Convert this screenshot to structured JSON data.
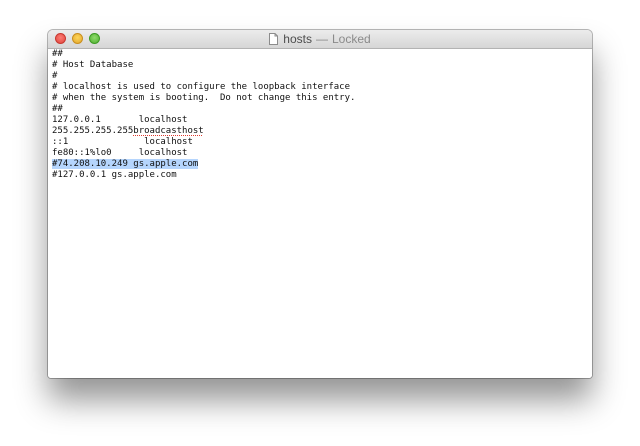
{
  "window": {
    "filename": "hosts",
    "separator": "—",
    "status": "Locked",
    "icon": "document-icon"
  },
  "colors": {
    "selection": "#b5d5fd",
    "close": "#e0443e",
    "minimize": "#e1a52c",
    "zoom": "#4fae30"
  },
  "lines": [
    "##",
    "# Host Database",
    "#",
    "# localhost is used to configure the loopback interface",
    "# when the system is booting.  Do not change this entry.",
    "##",
    "127.0.0.1       localhost",
    "255.255.255.255",
    "::1              localhost",
    "fe80::1%lo0     localhost",
    "#74.208.10.249 gs.apple.com",
    "#127.0.0.1 gs.apple.com"
  ],
  "misspelled_word": "broadcasthost"
}
